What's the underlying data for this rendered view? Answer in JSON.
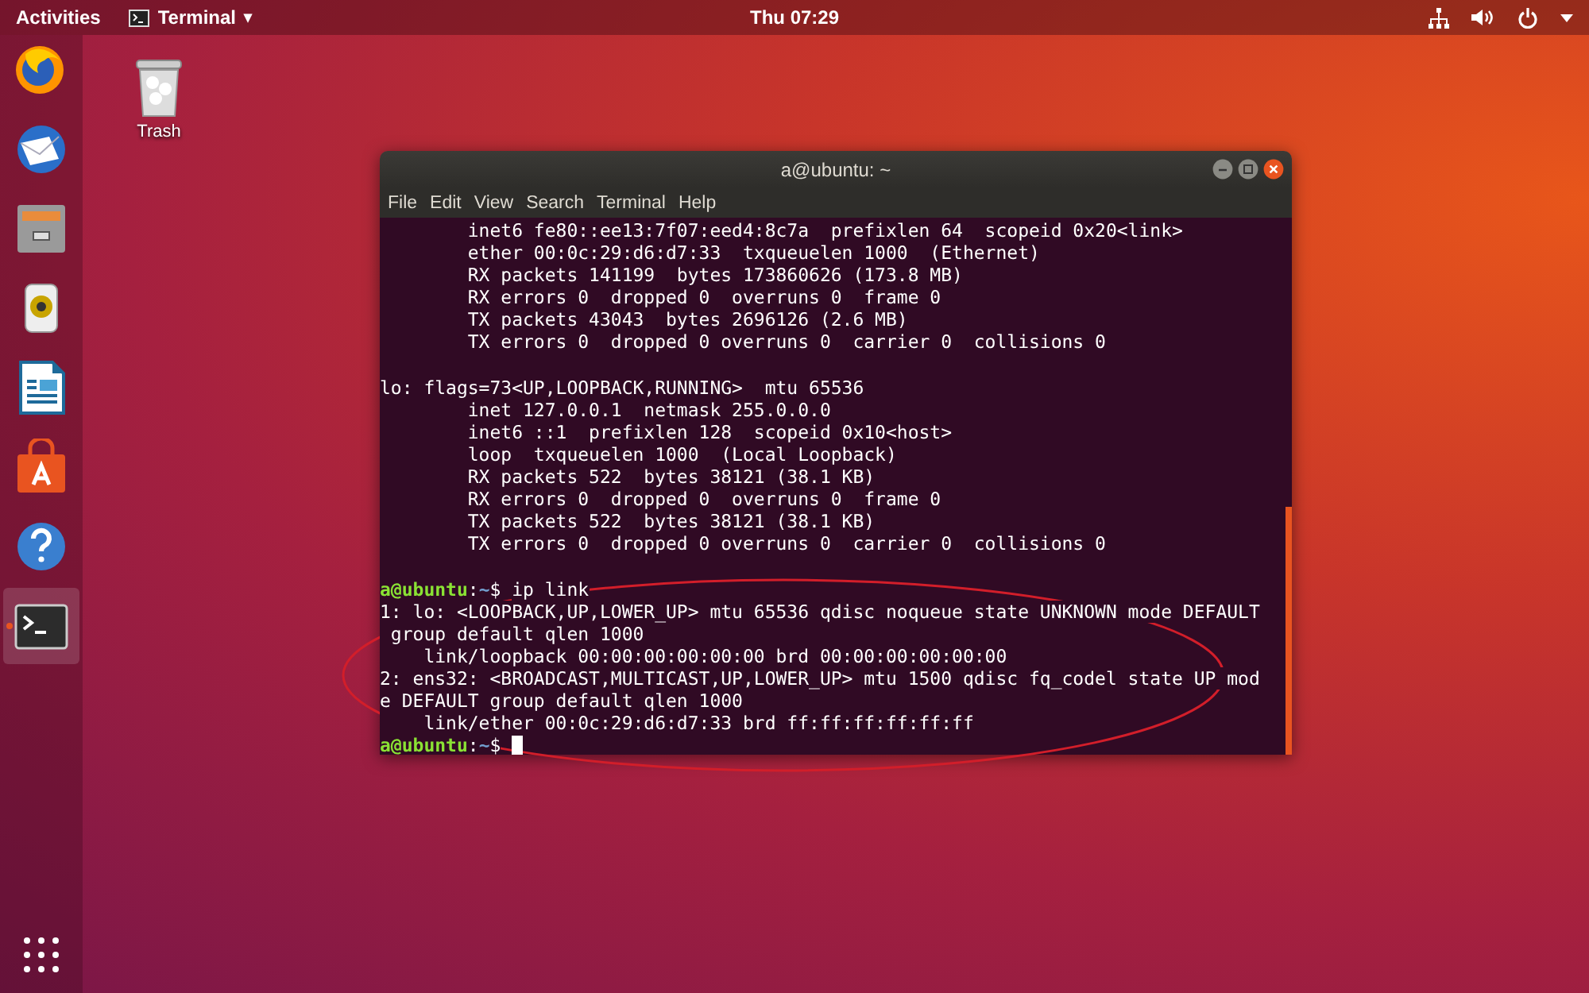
{
  "top_bar": {
    "activities": "Activities",
    "app_menu": {
      "label": "Terminal",
      "caret": "▾"
    },
    "clock": "Thu 07:29"
  },
  "dock": {
    "items": [
      {
        "kind": "firefox",
        "running": false
      },
      {
        "kind": "thunderbird",
        "running": false
      },
      {
        "kind": "files",
        "running": false
      },
      {
        "kind": "rhythmbox",
        "running": false
      },
      {
        "kind": "writer",
        "running": false
      },
      {
        "kind": "software",
        "running": false
      },
      {
        "kind": "help",
        "running": false
      },
      {
        "kind": "terminal",
        "running": true
      }
    ]
  },
  "desktop_icons": [
    {
      "label": "Trash"
    }
  ],
  "window": {
    "title": "a@ubuntu: ~",
    "menu": [
      "File",
      "Edit",
      "View",
      "Search",
      "Terminal",
      "Help"
    ],
    "lines": [
      {
        "kind": "output",
        "text": "        inet6 fe80::ee13:7f07:eed4:8c7a  prefixlen 64  scopeid 0x20<link>"
      },
      {
        "kind": "output",
        "text": "        ether 00:0c:29:d6:d7:33  txqueuelen 1000  (Ethernet)"
      },
      {
        "kind": "output",
        "text": "        RX packets 141199  bytes 173860626 (173.8 MB)"
      },
      {
        "kind": "output",
        "text": "        RX errors 0  dropped 0  overruns 0  frame 0"
      },
      {
        "kind": "output",
        "text": "        TX packets 43043  bytes 2696126 (2.6 MB)"
      },
      {
        "kind": "output",
        "text": "        TX errors 0  dropped 0 overruns 0  carrier 0  collisions 0"
      },
      {
        "kind": "blank"
      },
      {
        "kind": "output",
        "text": "lo: flags=73<UP,LOOPBACK,RUNNING>  mtu 65536"
      },
      {
        "kind": "output",
        "text": "        inet 127.0.0.1  netmask 255.0.0.0"
      },
      {
        "kind": "output",
        "text": "        inet6 ::1  prefixlen 128  scopeid 0x10<host>"
      },
      {
        "kind": "output",
        "text": "        loop  txqueuelen 1000  (Local Loopback)"
      },
      {
        "kind": "output",
        "text": "        RX packets 522  bytes 38121 (38.1 KB)"
      },
      {
        "kind": "output",
        "text": "        RX errors 0  dropped 0  overruns 0  frame 0"
      },
      {
        "kind": "output",
        "text": "        TX packets 522  bytes 38121 (38.1 KB)"
      },
      {
        "kind": "output",
        "text": "        TX errors 0  dropped 0 overruns 0  carrier 0  collisions 0"
      },
      {
        "kind": "blank"
      },
      {
        "kind": "prompt",
        "user": "a@ubuntu",
        "separator": ":",
        "path": "~",
        "symbol": "$",
        "command": "ip link"
      },
      {
        "kind": "output",
        "text": "1: lo: <LOOPBACK,UP,LOWER_UP> mtu 65536 qdisc noqueue state UNKNOWN mode DEFAULT"
      },
      {
        "kind": "output",
        "text": " group default qlen 1000"
      },
      {
        "kind": "output",
        "text": "    link/loopback 00:00:00:00:00:00 brd 00:00:00:00:00:00"
      },
      {
        "kind": "output",
        "text": "2: ens32: <BROADCAST,MULTICAST,UP,LOWER_UP> mtu 1500 qdisc fq_codel state UP mod"
      },
      {
        "kind": "output",
        "text": "e DEFAULT group default qlen 1000"
      },
      {
        "kind": "output",
        "text": "    link/ether 00:0c:29:d6:d7:33 brd ff:ff:ff:ff:ff:ff"
      },
      {
        "kind": "prompt",
        "user": "a@ubuntu",
        "separator": ":",
        "path": "~",
        "symbol": "$",
        "cursor": true
      }
    ]
  }
}
